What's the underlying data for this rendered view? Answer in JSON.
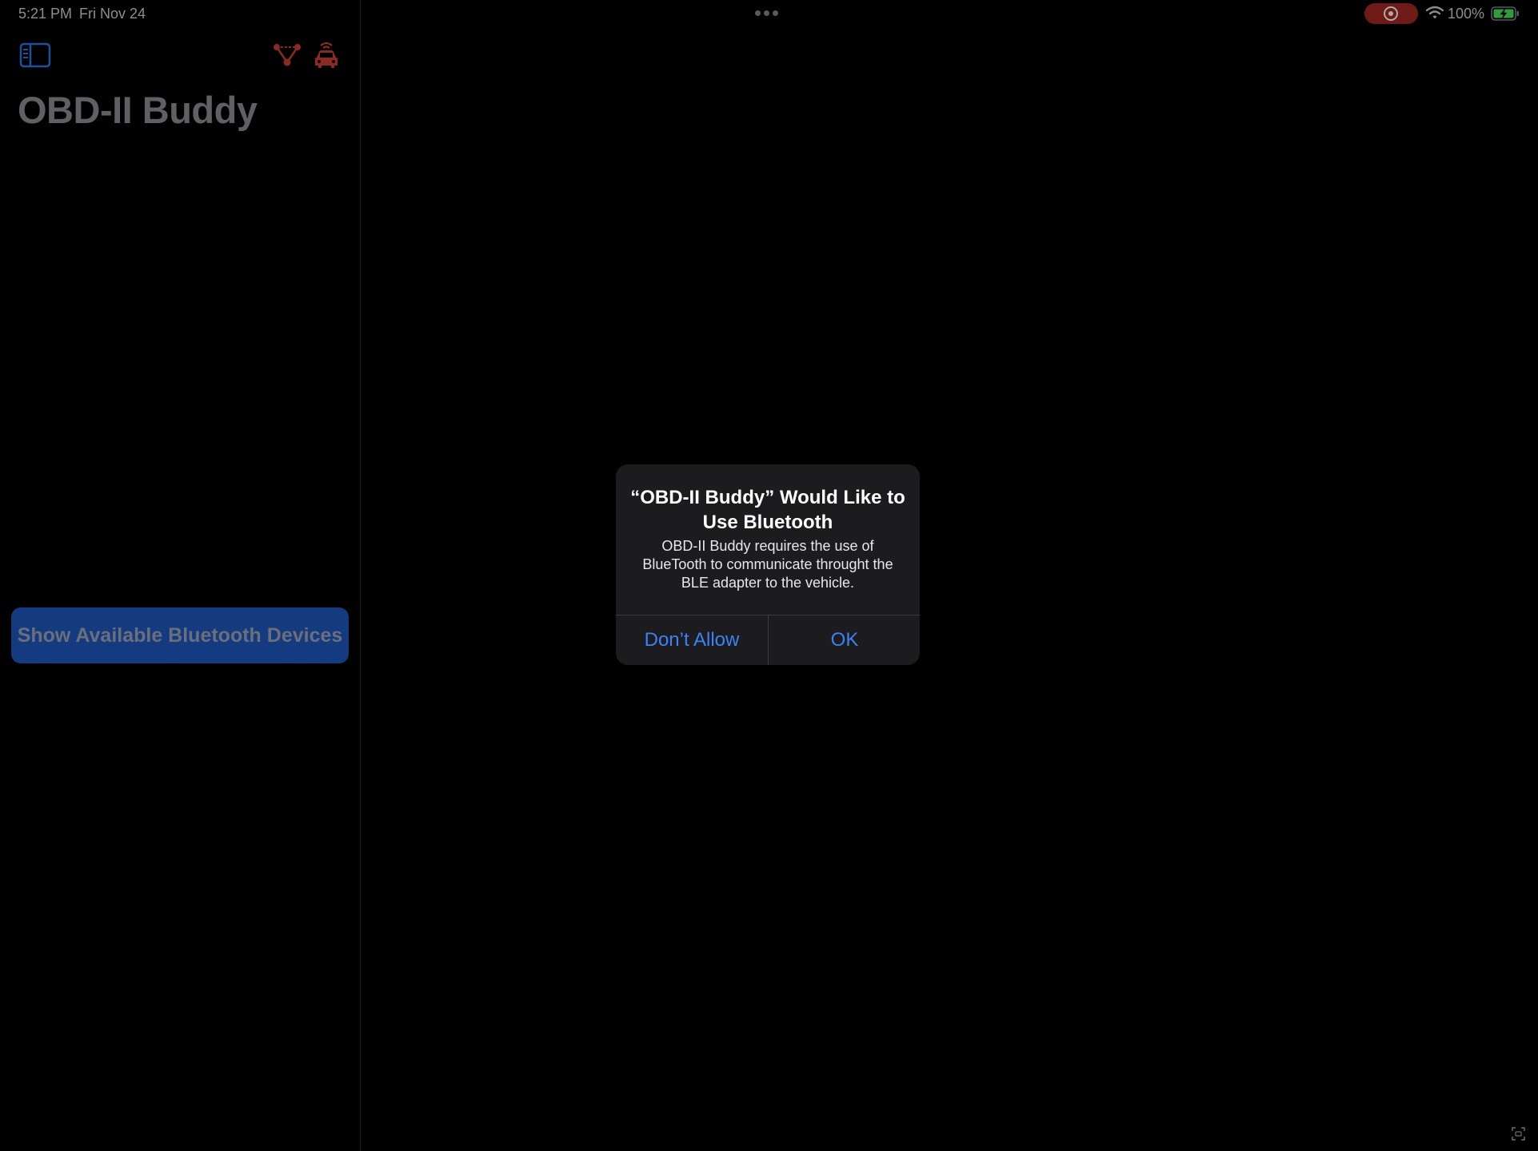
{
  "status_bar": {
    "time": "5:21 PM",
    "date": "Fri Nov 24",
    "battery_percent": "100%",
    "recording": true,
    "icons": [
      "multitasking-dots-icon",
      "record-icon",
      "wifi-icon",
      "battery-charging-icon"
    ]
  },
  "sidebar": {
    "title": "OBD-II Buddy",
    "toolbar_icons": [
      "sidebar-toggle-icon",
      "network-icon",
      "car-icon"
    ],
    "bluetooth_button_label": "Show Available Bluetooth Devices"
  },
  "alert": {
    "title": "“OBD-II Buddy” Would Like to Use Bluetooth",
    "message": "OBD-II Buddy requires the use of BlueTooth to communicate throught the BLE adapter to the vehicle.",
    "buttons": {
      "dont_allow": "Don’t Allow",
      "ok": "OK"
    }
  },
  "colors": {
    "accent": "#3b82f6",
    "button_bg": "#143a80",
    "toolbar_icon": "#8b2a22",
    "alert_bg": "#1c1c1e"
  }
}
